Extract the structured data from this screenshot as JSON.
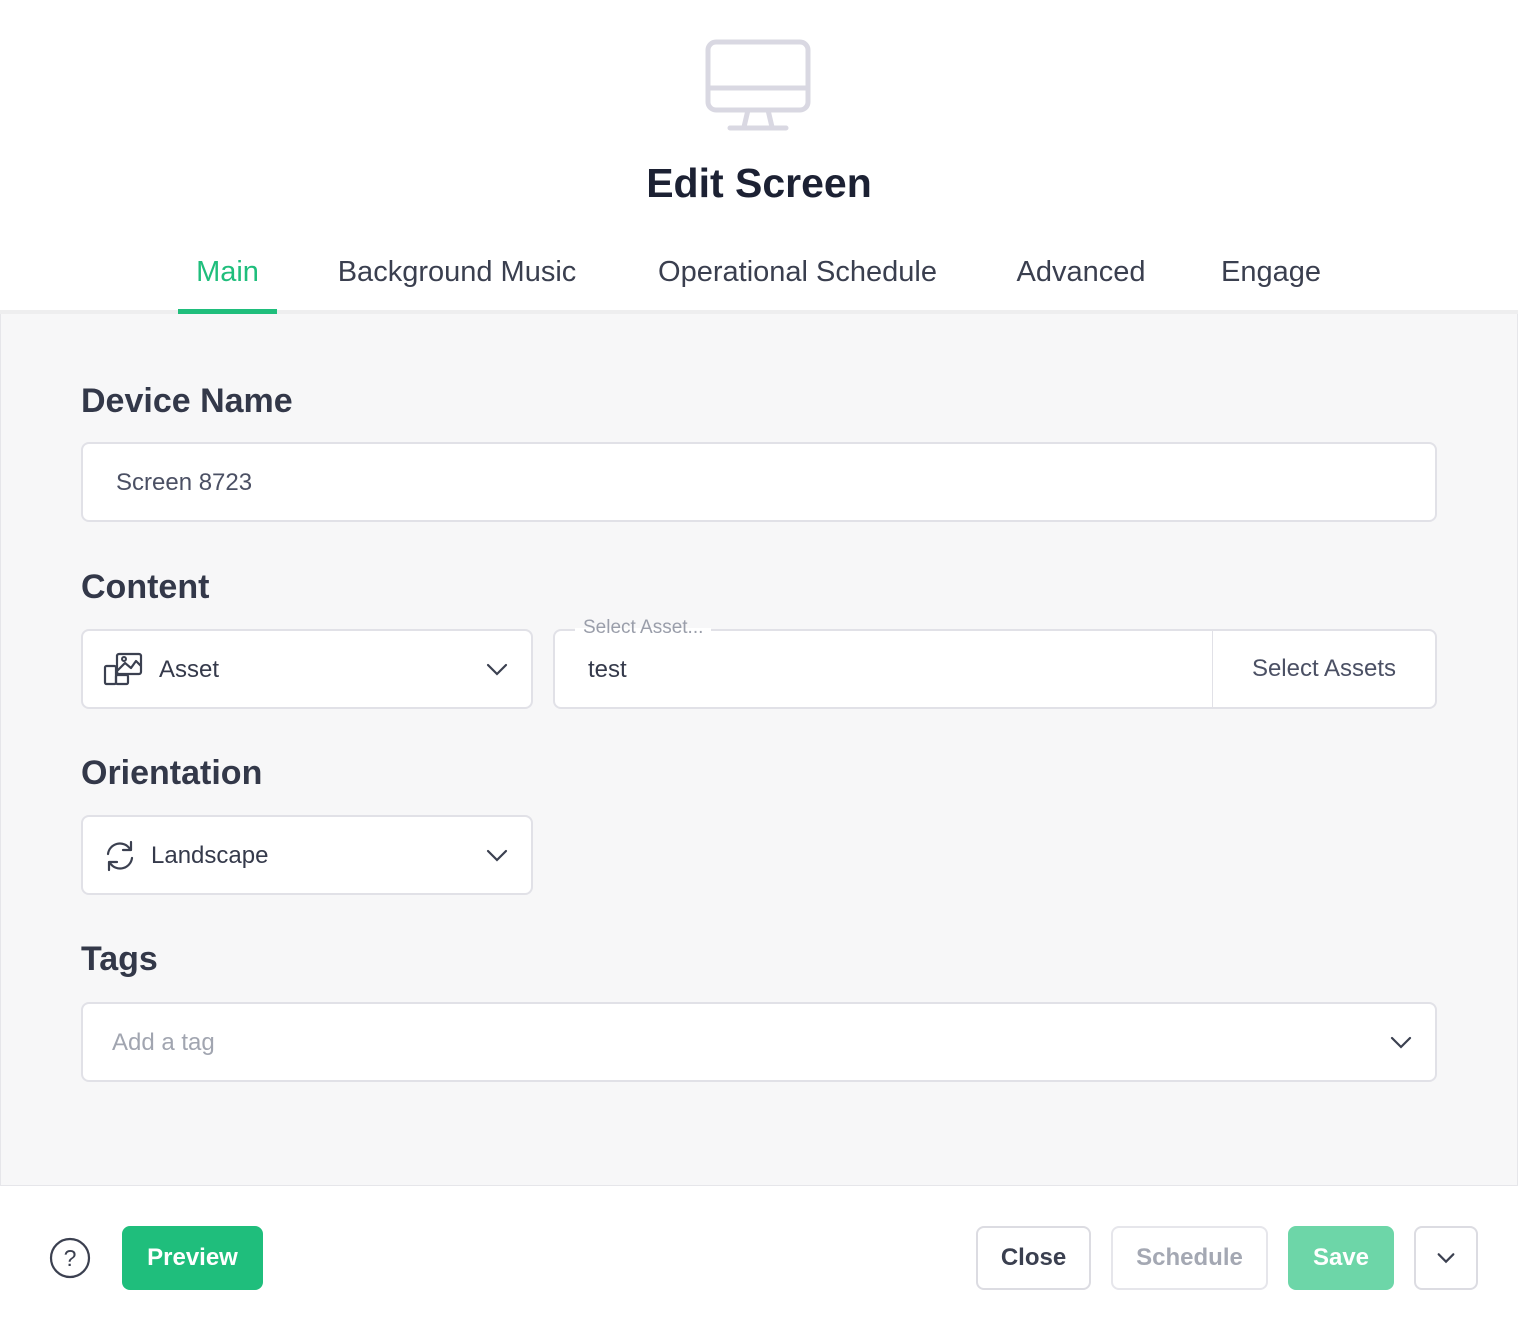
{
  "header": {
    "title": "Edit Screen",
    "icon": "monitor-icon"
  },
  "tabs": [
    {
      "label": "Main",
      "active": true
    },
    {
      "label": "Background Music",
      "active": false
    },
    {
      "label": "Operational Schedule",
      "active": false
    },
    {
      "label": "Advanced",
      "active": false
    },
    {
      "label": "Engage",
      "active": false
    }
  ],
  "device_name": {
    "label": "Device Name",
    "value": "Screen 8723"
  },
  "content": {
    "label": "Content",
    "type_select": {
      "value": "Asset",
      "icon": "asset-gallery-icon"
    },
    "asset_field": {
      "floating_label": "Select Asset...",
      "value": "test"
    },
    "select_assets_label": "Select Assets"
  },
  "orientation": {
    "label": "Orientation",
    "value": "Landscape",
    "icon": "rotate-icon"
  },
  "tags": {
    "label": "Tags",
    "placeholder": "Add a tag"
  },
  "footer": {
    "help_icon": "help-icon",
    "preview_label": "Preview",
    "close_label": "Close",
    "schedule_label": "Schedule",
    "save_label": "Save",
    "more_icon": "chevron-down-icon"
  },
  "colors": {
    "accent": "#1fbe7c",
    "save_disabled": "#6dd6a8",
    "icon_muted": "#d9d8e2"
  }
}
